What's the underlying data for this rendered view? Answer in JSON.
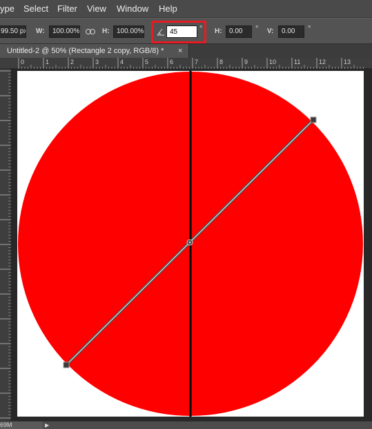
{
  "menu": {
    "items": [
      "ype",
      "Select",
      "Filter",
      "View",
      "Window",
      "Help"
    ]
  },
  "options": {
    "x_value": "99.50 px",
    "w_label": "W:",
    "w_value": "100.00%",
    "h_label": "H:",
    "h_value": "100.00%",
    "angle_value": "45",
    "degree_symbol": "°",
    "skew_h_label": "H:",
    "skew_h_value": "0.00",
    "skew_v_label": "V:",
    "skew_v_value": "0.00"
  },
  "tab": {
    "title": "Untitled-2 @ 50% (Rectangle 2 copy, RGB/8) *",
    "close": "×"
  },
  "ruler": {
    "labels": [
      "0",
      "1",
      "2",
      "3",
      "4",
      "5",
      "6",
      "7",
      "8",
      "9",
      "10",
      "11",
      "12",
      "13"
    ]
  },
  "canvas": {
    "circle_color": "#ff0000",
    "line_color": "#000000",
    "rotation_angle_deg": 45
  },
  "status": {
    "doc_size": "69M",
    "arrow": "▶"
  },
  "colors": {
    "highlight": "#e81b23",
    "ui_background": "#535353"
  }
}
